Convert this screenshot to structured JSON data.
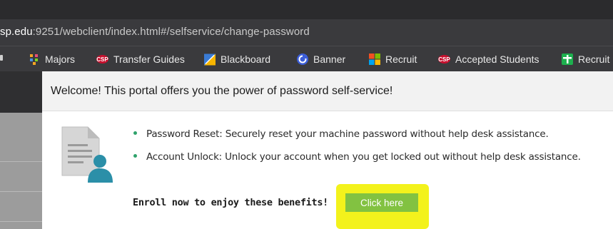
{
  "browser": {
    "url_host": "sp.edu",
    "url_path": ":9251/webclient/index.html#/selfservice/change-password"
  },
  "bookmarks": [
    {
      "label": "Majors",
      "icon": "majors-icon",
      "color": "#f5a623"
    },
    {
      "label": "Transfer Guides",
      "icon": "csp-logo-icon",
      "color": "#c8102e"
    },
    {
      "label": "Blackboard",
      "icon": "blackboard-icon",
      "color": "#f7b500"
    },
    {
      "label": "Banner",
      "icon": "banner-icon",
      "color": "#3c5ed8"
    },
    {
      "label": "Recruit",
      "icon": "recruit-icon",
      "color": "#f25022"
    },
    {
      "label": "Accepted Students",
      "icon": "csp-logo-icon",
      "color": "#c8102e"
    },
    {
      "label": "Recruit",
      "icon": "recruit-plus-icon",
      "color": "#1db04e"
    }
  ],
  "portal": {
    "welcome": "Welcome! This portal offers you the power of password self-service!",
    "bullets": [
      "Password Reset: Securely reset your machine password without help desk assistance.",
      "Account Unlock: Unlock your account when you get locked out without help desk assistance."
    ],
    "enroll_text": "Enroll now to enjoy these benefits!",
    "button_label": "Click here"
  },
  "colors": {
    "button_green": "#82c241",
    "highlight_yellow": "#f3f21c",
    "bullet_green": "#2fa26b",
    "icon_teal": "#2b8fa8"
  }
}
